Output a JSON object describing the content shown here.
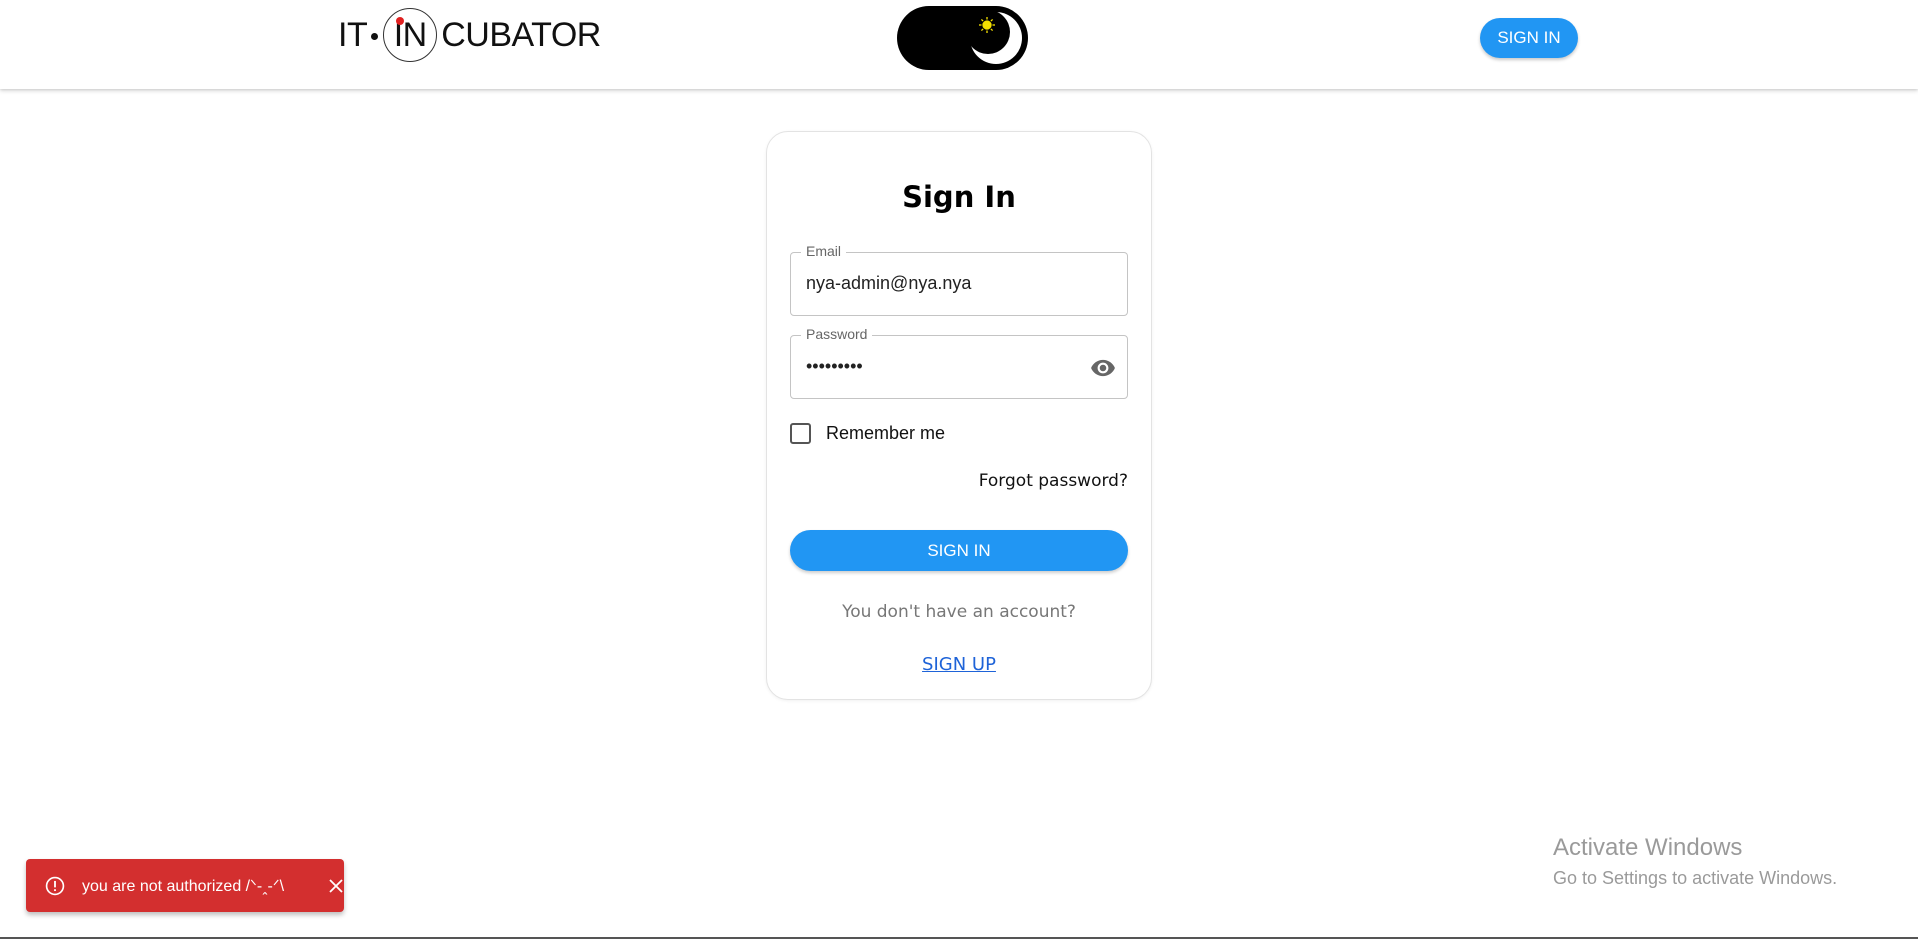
{
  "header": {
    "logo": {
      "part1": "IT",
      "part2": "IN",
      "part3": "CUBATOR"
    },
    "theme_toggle": {
      "icon": "moon-sun-icon"
    },
    "signin_label": "SIGN IN"
  },
  "form": {
    "title": "Sign In",
    "email": {
      "label": "Email",
      "value": "nya-admin@nya.nya"
    },
    "password": {
      "label": "Password",
      "value": "•••••••••",
      "icon": "eye-icon"
    },
    "remember": {
      "label": "Remember me",
      "checked": false
    },
    "forgot_label": "Forgot password?",
    "signin_label": "SIGN IN",
    "no_account_text": "You don't have an account?",
    "signup_label": "SIGN UP"
  },
  "toast": {
    "message": "you are not authorized /ᐠ-ꞈ-ᐟ\\",
    "icon": "error-icon",
    "close_icon": "close-icon",
    "color": "#d32f2f"
  },
  "watermark": {
    "title": "Activate Windows",
    "subtitle": "Go to Settings to activate Windows."
  },
  "colors": {
    "primary": "#2196f3",
    "link": "#1e63d8",
    "error": "#d32f2f"
  }
}
